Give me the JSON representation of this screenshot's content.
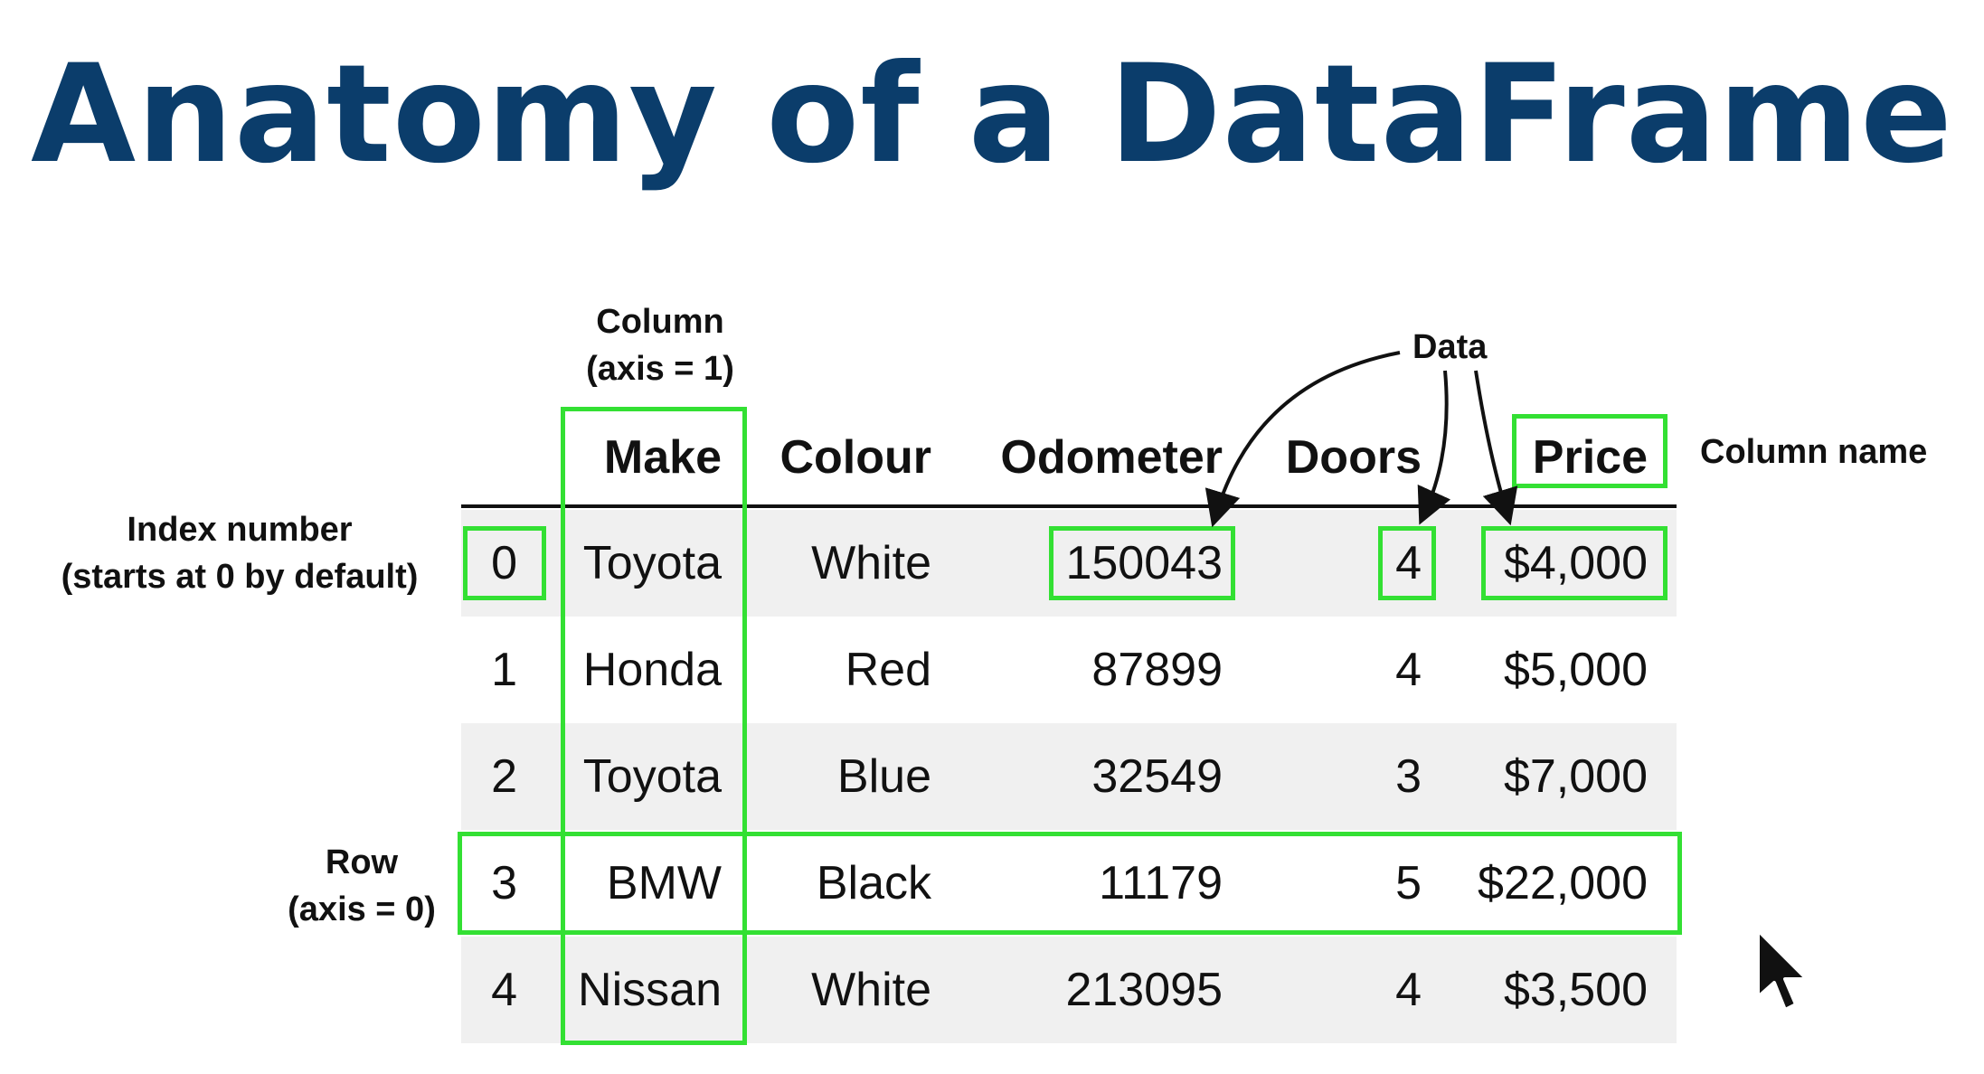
{
  "title": "Anatomy of a DataFrame",
  "annotations": {
    "column_line1": "Column",
    "column_line2": "(axis = 1)",
    "data": "Data",
    "column_name": "Column name",
    "index_line1": "Index number",
    "index_line2": "(starts at 0 by default)",
    "row_line1": "Row",
    "row_line2": "(axis = 0)"
  },
  "table": {
    "columns": [
      "Make",
      "Colour",
      "Odometer",
      "Doors",
      "Price"
    ],
    "rows": [
      {
        "index": "0",
        "cells": [
          "Toyota",
          "White",
          "150043",
          "4",
          "$4,000"
        ]
      },
      {
        "index": "1",
        "cells": [
          "Honda",
          "Red",
          "87899",
          "4",
          "$5,000"
        ]
      },
      {
        "index": "2",
        "cells": [
          "Toyota",
          "Blue",
          "32549",
          "3",
          "$7,000"
        ]
      },
      {
        "index": "3",
        "cells": [
          "BMW",
          "Black",
          "11179",
          "5",
          "$22,000"
        ]
      },
      {
        "index": "4",
        "cells": [
          "Nissan",
          "White",
          "213095",
          "4",
          "$3,500"
        ]
      }
    ]
  },
  "colors": {
    "title": "#0b3d6b",
    "highlight": "#33e033",
    "stripe": "#f0f0f0"
  },
  "icons": {
    "cursor": "mouse-pointer-icon"
  }
}
